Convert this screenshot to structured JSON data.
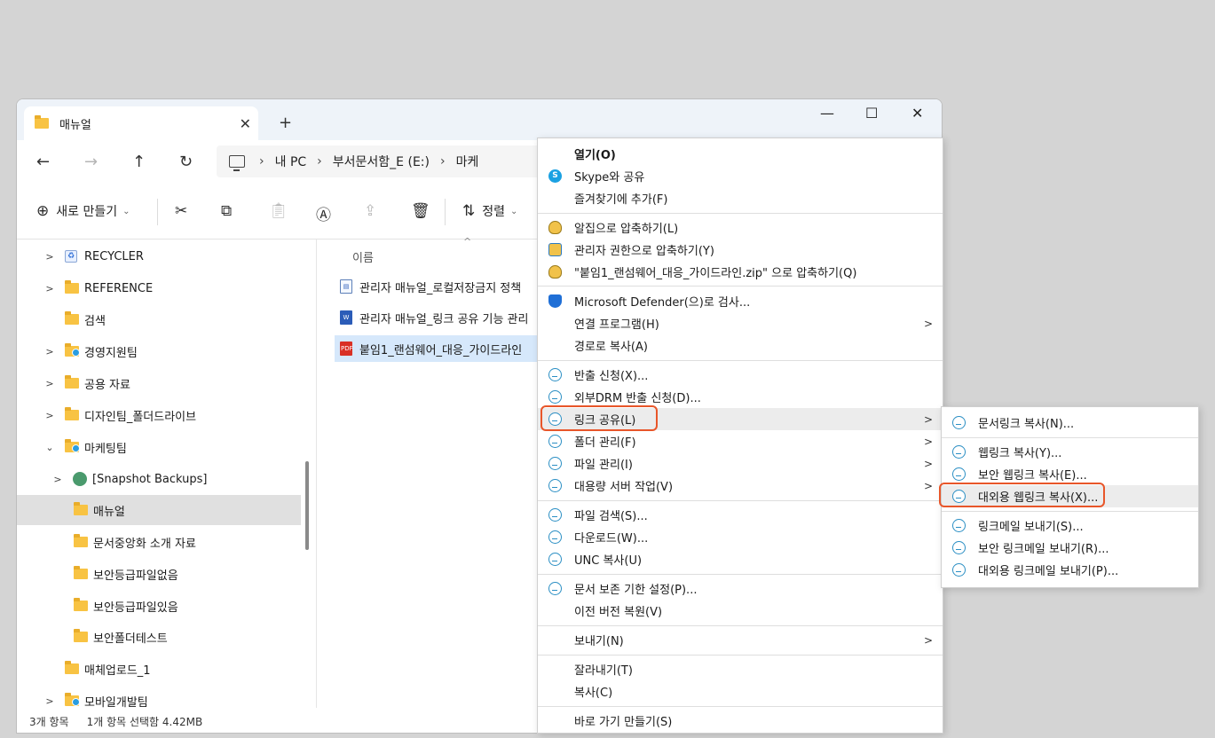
{
  "window": {
    "tab_title": "매뉴얼",
    "tab_close": "✕",
    "new_tab": "+",
    "minimize": "—",
    "maximize": "☐",
    "close": "✕"
  },
  "nav": {
    "back": "←",
    "forward": "→",
    "up": "↑",
    "refresh": "↻",
    "breadcrumb": [
      "내 PC",
      "부서문서함_E (E:)",
      "마케"
    ]
  },
  "toolbar": {
    "new_label": "새로 만들기",
    "sort_label": "정렬",
    "icons": [
      "cut-icon",
      "copy-icon",
      "paste-icon",
      "rename-icon",
      "share-icon",
      "delete-icon"
    ]
  },
  "sidebar": {
    "items": [
      {
        "label": "RECYCLER",
        "chevron": ">",
        "icon": "recycle-icon"
      },
      {
        "label": "REFERENCE",
        "chevron": ">",
        "icon": "folder-icon"
      },
      {
        "label": "검색",
        "chevron": "",
        "icon": "folder-icon"
      },
      {
        "label": "경영지원팀",
        "chevron": ">",
        "icon": "shared-folder-icon"
      },
      {
        "label": "공용 자료",
        "chevron": ">",
        "icon": "folder-icon"
      },
      {
        "label": "디자인팀_폴더드라이브",
        "chevron": ">",
        "icon": "folder-icon"
      },
      {
        "label": "마케팅팀",
        "chevron": "⌄",
        "icon": "shared-folder-icon"
      },
      {
        "label": "[Snapshot Backups]",
        "chevron": ">",
        "icon": "snapshot-icon"
      },
      {
        "label": "매뉴얼",
        "chevron": "",
        "icon": "folder-icon"
      },
      {
        "label": "문서중앙화 소개 자료",
        "chevron": "",
        "icon": "folder-icon"
      },
      {
        "label": "보안등급파일없음",
        "chevron": "",
        "icon": "folder-icon"
      },
      {
        "label": "보안등급파일있음",
        "chevron": "",
        "icon": "folder-icon"
      },
      {
        "label": "보안폴더테스트",
        "chevron": "",
        "icon": "folder-icon"
      },
      {
        "label": "매체업로드_1",
        "chevron": "",
        "icon": "folder-icon"
      },
      {
        "label": "모바일개발팀",
        "chevron": ">",
        "icon": "shared-folder-icon"
      }
    ]
  },
  "content": {
    "column_name": "이름",
    "files": [
      {
        "name": "관리자 매뉴얼_로컬저장금지 정책",
        "type": "doc"
      },
      {
        "name": "관리자 매뉴얼_링크 공유 기능 관리",
        "type": "word"
      },
      {
        "name": "붙임1_랜섬웨어_대응_가이드라인",
        "type": "pdf"
      }
    ]
  },
  "status": {
    "count": "3개 항목",
    "selection": "1개 항목 선택함 4.42MB"
  },
  "context_menu": {
    "open": "열기(O)",
    "skype_share": "Skype와 공유",
    "add_favorite": "즐겨찾기에 추가(F)",
    "alzip": "알집으로 압축하기(L)",
    "alzip_admin": "관리자 권한으로 압축하기(Y)",
    "alzip_named": "\"붙임1_랜섬웨어_대응_가이드라인.zip\" 으로 압축하기(Q)",
    "defender": "Microsoft Defender(으)로 검사...",
    "open_with": "연결 프로그램(H)",
    "copy_path": "경로로 복사(A)",
    "export_request": "반출 신청(X)...",
    "drm_export": "외부DRM 반출 신청(D)...",
    "link_share": "링크 공유(L)",
    "folder_manage": "폴더 관리(F)",
    "file_manage": "파일 관리(I)",
    "large_server": "대용량 서버 작업(V)",
    "file_search": "파일 검색(S)...",
    "download": "다운로드(W)...",
    "unc_copy": "UNC 복사(U)",
    "retention": "문서 보존 기한 설정(P)...",
    "restore": "이전 버전 복원(V)",
    "send_to": "보내기(N)",
    "cut": "잘라내기(T)",
    "copy": "복사(C)",
    "shortcut": "바로 가기 만들기(S)",
    "arrow": ">"
  },
  "submenu": {
    "doc_link": "문서링크 복사(N)...",
    "web_link": "웹링크 복사(Y)...",
    "secure_web_link": "보안 웹링크 복사(E)...",
    "external_web_link": "대외용 웹링크 복사(X)...",
    "link_mail": "링크메일 보내기(S)...",
    "secure_link_mail": "보안 링크메일 보내기(R)...",
    "external_link_mail": "대외용 링크메일 보내기(P)..."
  },
  "colors": {
    "highlight": "#e8562a",
    "selection": "#d6e8fb",
    "folder": "#f8c343"
  }
}
